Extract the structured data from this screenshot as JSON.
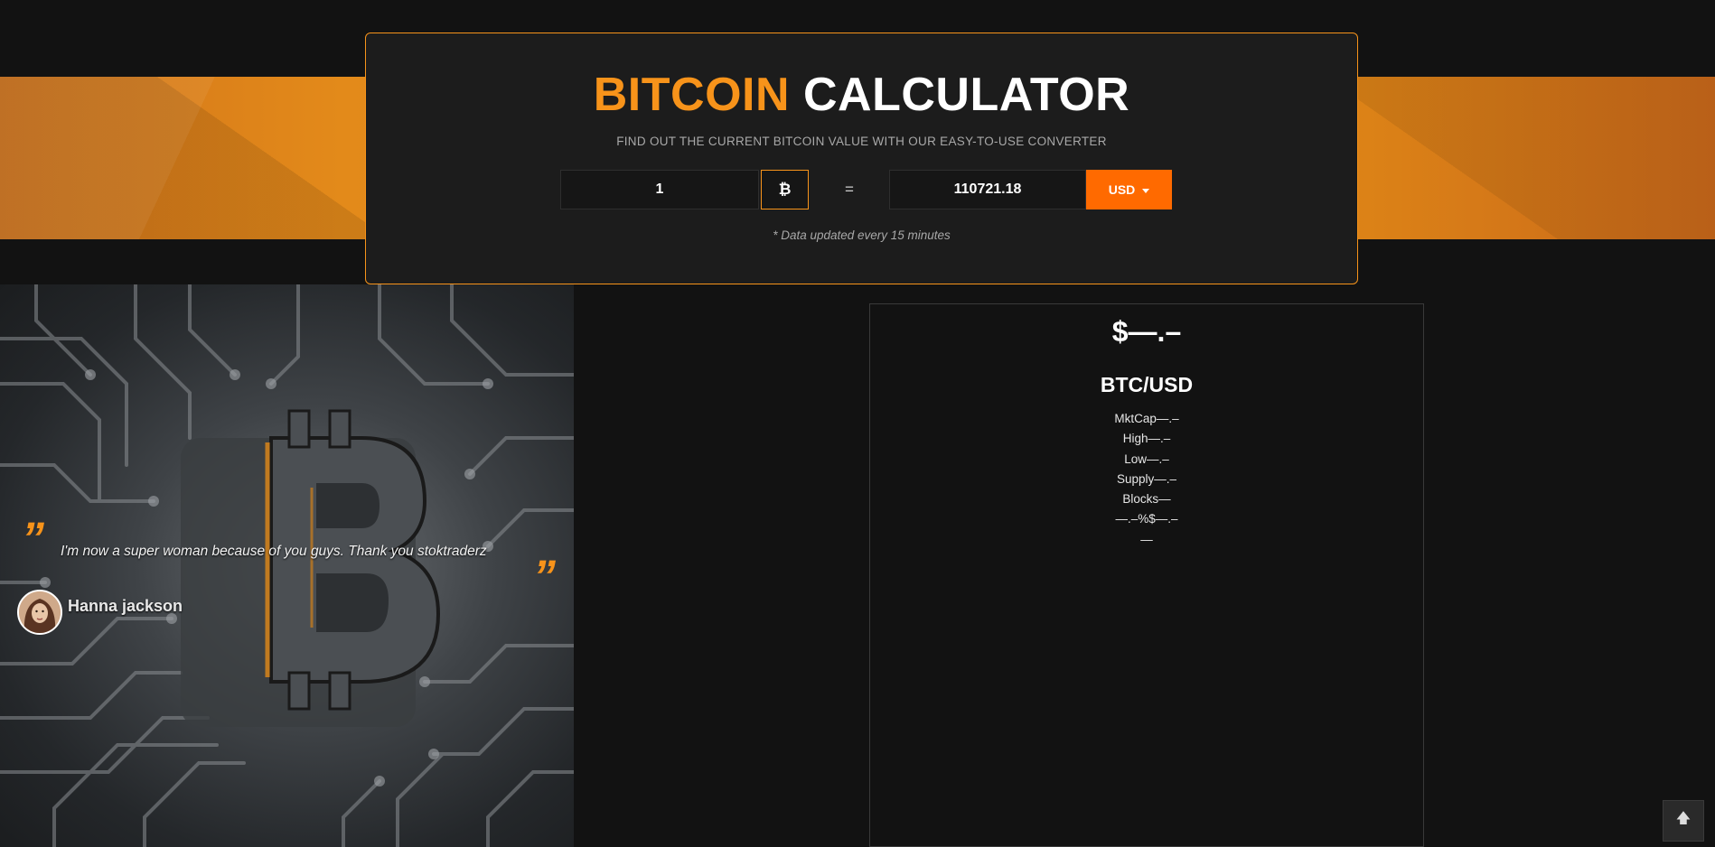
{
  "calculator": {
    "title_accent": "BITCOIN",
    "title_main": "CALCULATOR",
    "subtitle": "FIND OUT THE CURRENT BITCOIN VALUE WITH OUR EASY-TO-USE CONVERTER",
    "btc_amount": "1",
    "btc_symbol": "₿",
    "equals": "=",
    "fiat_amount": "110721.18",
    "currency": "USD",
    "note": "* Data updated every 15 minutes"
  },
  "testimonial": {
    "quote": "I'm now a super woman because of you guys. Thank you stoktraderz",
    "author": "Hanna jackson",
    "open_quote_glyph": "”",
    "close_quote_glyph": "”"
  },
  "ticker": {
    "price": "$—.–",
    "pair": "BTC/USD",
    "stats": [
      "MktCap—.–",
      "High—.–",
      "Low—.–",
      "Supply—.–",
      "Blocks—",
      "—.–%$—.–",
      "—"
    ]
  },
  "back_to_top_icon": "arrow-up-icon",
  "colors": {
    "accent": "#f7931a",
    "button": "#ff6a00",
    "background": "#121212"
  }
}
